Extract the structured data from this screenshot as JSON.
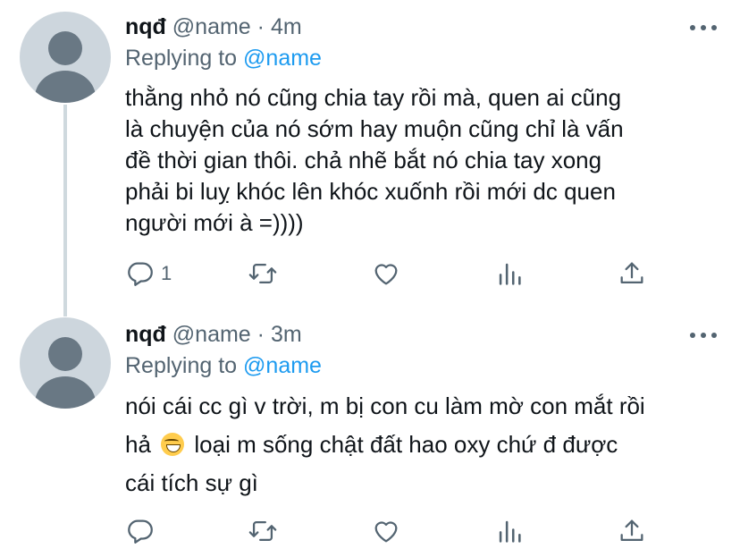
{
  "tweets": [
    {
      "display_name": "nqđ",
      "handle": "@name",
      "separator": "·",
      "time": "4m",
      "replying_prefix": "Replying to",
      "replying_to": "@name",
      "lines": [
        "thằng nhỏ nó cũng chia tay rồi mà, quen ai cũng",
        "là chuyện của nó sớm hay muộn cũng chỉ là vấn",
        "đề thời gian thôi. chả nhẽ bắt nó chia tay xong",
        "phải bi luỵ khóc lên khóc xuốnh rồi mới dc quen",
        "người mới à =))))"
      ],
      "reply_count": "1"
    },
    {
      "display_name": "nqđ",
      "handle": "@name",
      "separator": "·",
      "time": "3m",
      "replying_prefix": "Replying to",
      "replying_to": "@name",
      "line1": "nói cái cc gì v trời, m bị con cu làm mờ con mắt rồi",
      "line2_start": "hả",
      "line2_emoji": "😅",
      "line2_end": " loại m sống chật đất hao oxy chứ đ được",
      "line3": "cái tích sự gì",
      "reply_count": ""
    }
  ],
  "icons": {
    "reply": "speech-bubble-icon",
    "retweet": "retweet-icon",
    "like": "heart-icon",
    "views": "bar-chart-icon",
    "share": "share-upload-icon",
    "more": "more-horizontal-icon"
  },
  "colors": {
    "link": "#1d9bf0",
    "secondary_text": "#536471",
    "avatar_bg": "#cdd6dd",
    "avatar_fg": "#697884",
    "thread_line": "#cfd9de"
  }
}
